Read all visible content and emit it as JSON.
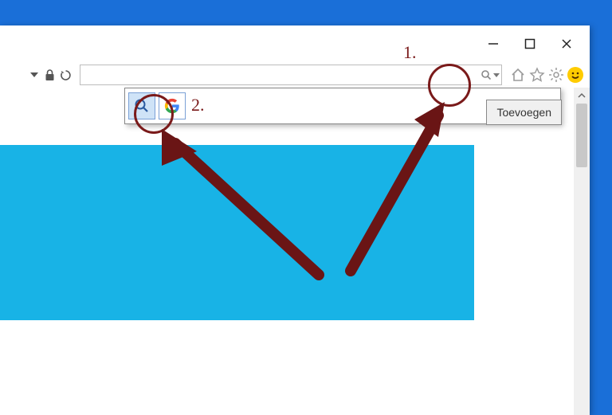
{
  "titlebar": {
    "minimize": "Minimize",
    "maximize": "Maximize",
    "close": "Close"
  },
  "toolbar": {
    "search_value": "",
    "search_placeholder": ""
  },
  "dropdown": {
    "providers": [
      "default-search",
      "google"
    ],
    "add_label": "Toevoegen"
  },
  "annotations": {
    "label1": "1.",
    "label2": "2."
  }
}
